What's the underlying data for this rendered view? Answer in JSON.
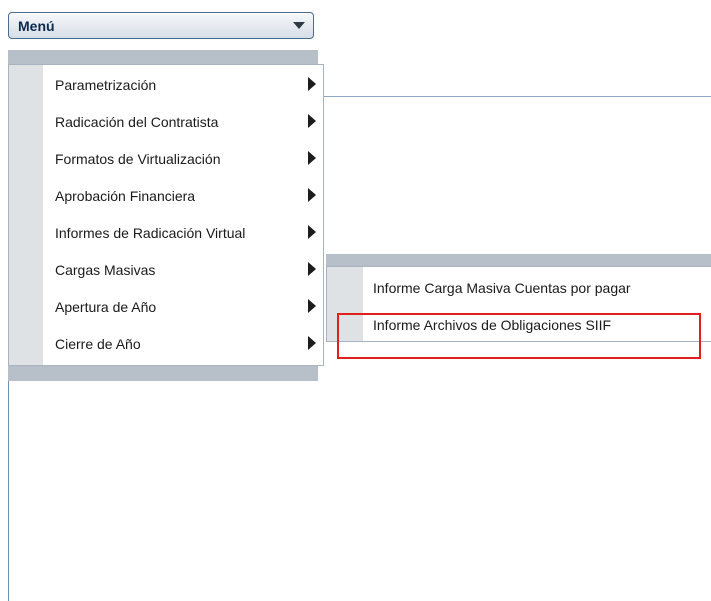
{
  "menu_button": {
    "label": "Menú",
    "icon": "caret-down-icon"
  },
  "main_menu": {
    "items": [
      {
        "label": "Parametrización",
        "icon": "submenu-arrow-icon"
      },
      {
        "label": "Radicación del Contratista",
        "icon": "submenu-arrow-icon"
      },
      {
        "label": "Formatos de Virtualización",
        "icon": "submenu-arrow-icon"
      },
      {
        "label": "Aprobación Financiera",
        "icon": "submenu-arrow-icon"
      },
      {
        "label": "Informes de Radicación Virtual",
        "icon": "submenu-arrow-icon"
      },
      {
        "label": "Cargas Masivas",
        "icon": "submenu-arrow-icon"
      },
      {
        "label": "Apertura de Año",
        "icon": "submenu-arrow-icon"
      },
      {
        "label": "Cierre de Año",
        "icon": "submenu-arrow-icon"
      }
    ]
  },
  "sub_menu": {
    "parent": "Cargas Masivas",
    "items": [
      {
        "label": "Informe Carga Masiva Cuentas por pagar"
      },
      {
        "label": "Informe Archivos de Obligaciones SIIF"
      }
    ]
  },
  "highlight": {
    "target": "Informe Archivos de Obligaciones SIIF",
    "color": "#e1201c"
  }
}
